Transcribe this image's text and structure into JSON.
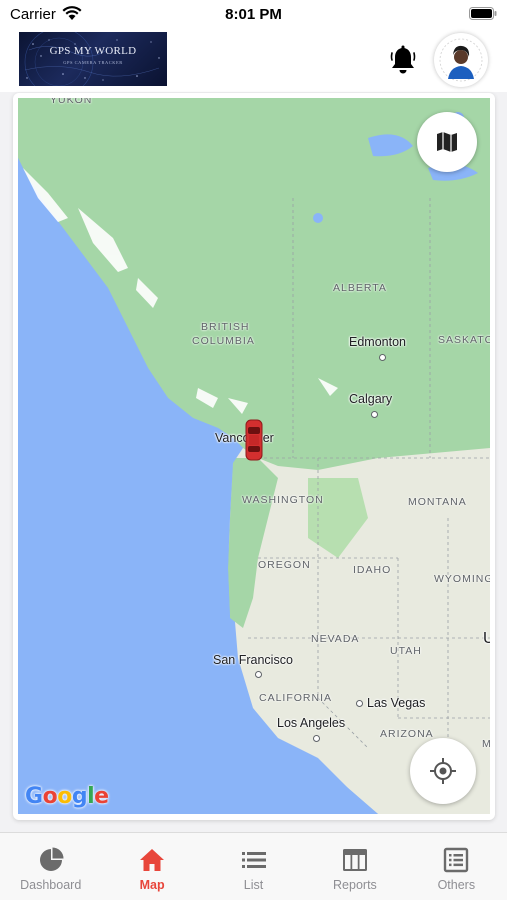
{
  "status_bar": {
    "carrier": "Carrier",
    "time": "8:01 PM"
  },
  "header": {
    "logo_title": "GPS MY WORLD",
    "logo_subtitle": "GPS CAMERA TRACKER",
    "bell_icon": "bell-icon",
    "avatar": "user-avatar"
  },
  "map": {
    "attribution": "Google",
    "labels": {
      "yukon": "YUKON",
      "british_columbia_1": "BRITISH",
      "british_columbia_2": "COLUMBIA",
      "alberta": "ALBERTA",
      "saskatchewan": "SASKATC",
      "edmonton": "Edmonton",
      "calgary": "Calgary",
      "vancouver": "Vancouver",
      "washington": "WASHINGTON",
      "montana": "MONTANA",
      "oregon": "OREGON",
      "idaho": "IDAHO",
      "wyoming": "WYOMING",
      "nevada": "NEVADA",
      "utah": "UTAH",
      "san_francisco": "San Francisco",
      "california": "CALIFORNIA",
      "las_vegas": "Las Vegas",
      "los_angeles": "Los Angeles",
      "arizona": "ARIZONA",
      "edge_u": "U",
      "edge_nm": "M"
    },
    "map_type_icon": "map-icon",
    "locate_icon": "crosshair-icon",
    "vehicle_icon": "car-icon",
    "colors": {
      "water": "#8ab4f8",
      "forest": "#a5d6a7",
      "land": "#e8eadf",
      "vehicle": "#d32f2f"
    }
  },
  "tabs": [
    {
      "label": "Dashboard",
      "icon": "pie-chart-icon",
      "active": false
    },
    {
      "label": "Map",
      "icon": "home-icon",
      "active": true
    },
    {
      "label": "List",
      "icon": "list-icon",
      "active": false
    },
    {
      "label": "Reports",
      "icon": "reports-icon",
      "active": false
    },
    {
      "label": "Others",
      "icon": "others-icon",
      "active": false
    }
  ],
  "accent_color": "#e8463b"
}
